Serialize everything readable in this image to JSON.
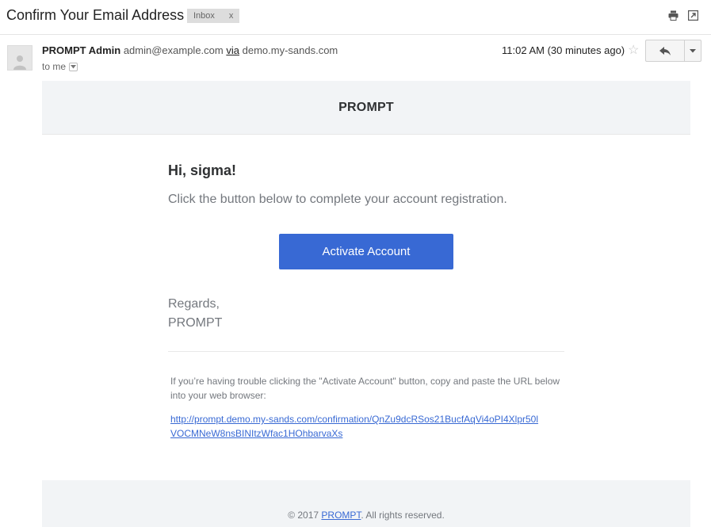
{
  "subject": "Confirm Your Email Address",
  "label": {
    "text": "Inbox",
    "close": "x"
  },
  "toolbar_icons": [
    "print-icon",
    "open-in-new-window-icon"
  ],
  "sender": {
    "name": "PROMPT Admin",
    "email": "admin@example.com",
    "via_label": "via",
    "via_domain": "demo.my-sands.com",
    "to": "to me"
  },
  "timestamp": "11:02 AM (30 minutes ago)",
  "email": {
    "brand": "PROMPT",
    "greeting": "Hi, sigma!",
    "intro": "Click the button below to complete your account registration.",
    "button": "Activate Account",
    "regards": "Regards,",
    "signature": "PROMPT",
    "trouble_text": "If you’re having trouble clicking the \"Activate Account\" button, copy and paste the URL below into your web browser:",
    "url": "http://prompt.demo.my-sands.com/confirmation/QnZu9dcRSos21BucfAqVi4oPI4Xlpr50lVOCMNeW8nsBINItzWfac1HOhbarvaXs",
    "footer_prefix": "© 2017 ",
    "footer_link": "PROMPT",
    "footer_suffix": ". All rights reserved."
  },
  "colors": {
    "button": "#3869d4",
    "link": "#3869d4",
    "header_bg": "#f2f4f6",
    "muted_text": "#74787e"
  }
}
